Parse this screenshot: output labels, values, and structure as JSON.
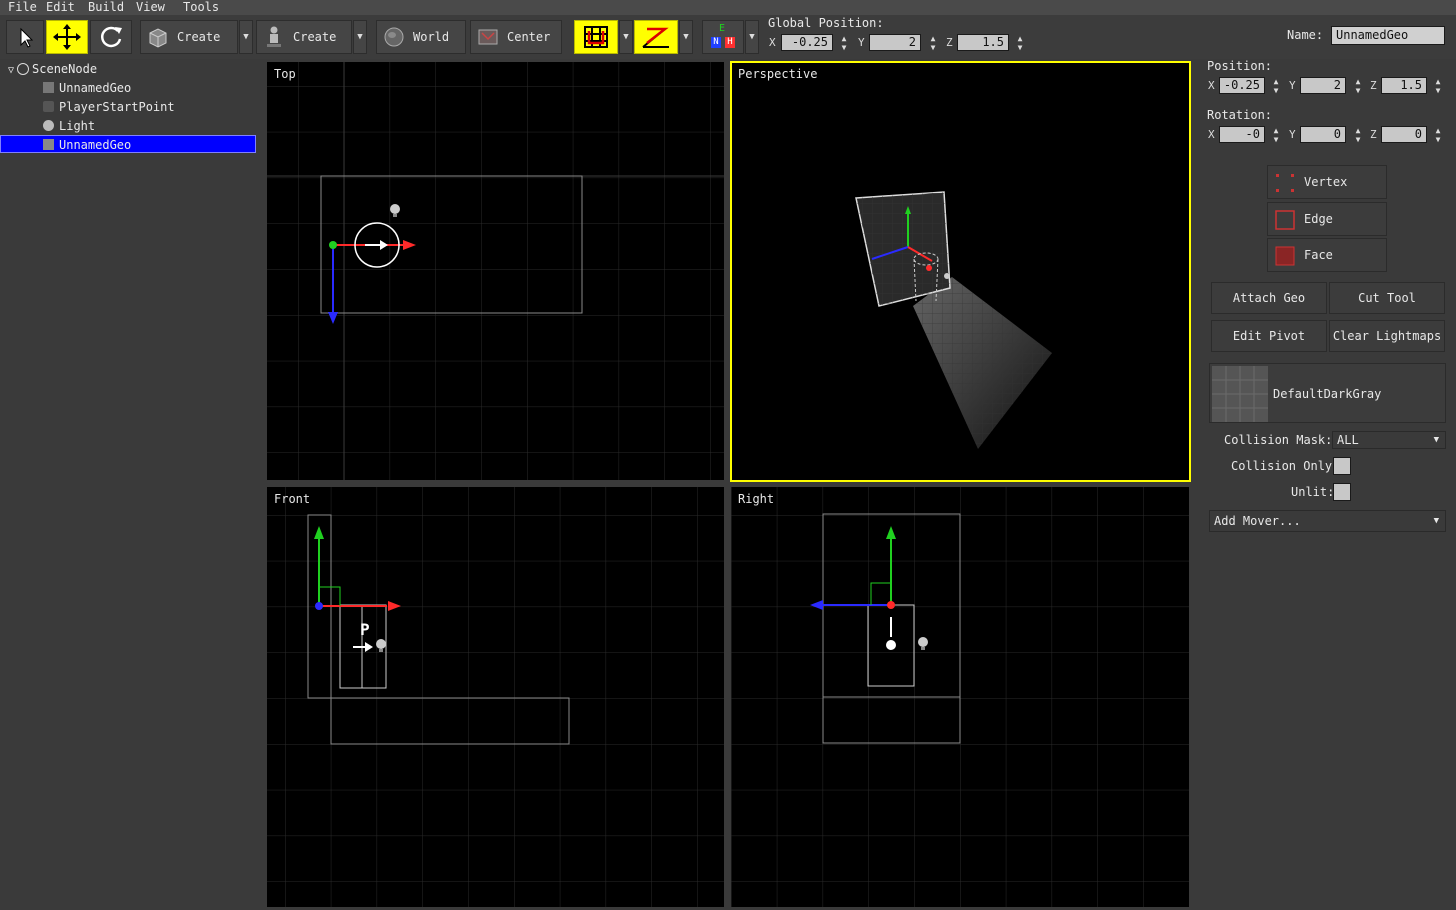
{
  "menu": {
    "file": "File",
    "edit": "Edit",
    "build": "Build",
    "view": "View",
    "tools": "Tools"
  },
  "toolbar": {
    "create_geo_label": "Create",
    "create_entity_label": "Create",
    "world_label": "World",
    "center_label": "Center",
    "global_position_label": "Global Position:",
    "axis_x": "X",
    "axis_y": "Y",
    "axis_z": "Z",
    "global_x": "-0.25",
    "global_y": "2",
    "global_z": "1.5",
    "mode_e": "E",
    "mode_n": "N",
    "mode_h": "H"
  },
  "tree": {
    "root": "SceneNode",
    "items": [
      {
        "label": "UnnamedGeo",
        "icon": "geo-icon"
      },
      {
        "label": "PlayerStartPoint",
        "icon": "player-icon"
      },
      {
        "label": "Light",
        "icon": "light-icon"
      },
      {
        "label": "UnnamedGeo",
        "icon": "geo-icon"
      }
    ]
  },
  "viewports": {
    "top": "Top",
    "perspective": "Perspective",
    "front": "Front",
    "right": "Right"
  },
  "panel": {
    "name_label": "Name:",
    "name_value": "UnnamedGeo",
    "position_label": "Position:",
    "pos_x": "-0.25",
    "pos_y": "2",
    "pos_z": "1.5",
    "rotation_label": "Rotation:",
    "rot_x": "-0",
    "rot_y": "0",
    "rot_z": "0",
    "axis_x": "X",
    "axis_y": "Y",
    "axis_z": "Z",
    "vertex_label": "Vertex",
    "edge_label": "Edge",
    "face_label": "Face",
    "attach_geo": "Attach Geo",
    "cut_tool": "Cut Tool",
    "edit_pivot": "Edit Pivot",
    "clear_lightmaps": "Clear Lightmaps",
    "material_name": "DefaultDarkGray",
    "collision_mask_label": "Collision Mask:",
    "collision_mask_value": "ALL",
    "collision_only_label": "Collision Only:",
    "unlit_label": "Unlit:",
    "add_mover": "Add Mover..."
  },
  "colors": {
    "accent": "#ffff00",
    "selection": "#0000ff",
    "axis_x": "#ff2a2a",
    "axis_y": "#20d020",
    "axis_z": "#2a2aff"
  }
}
